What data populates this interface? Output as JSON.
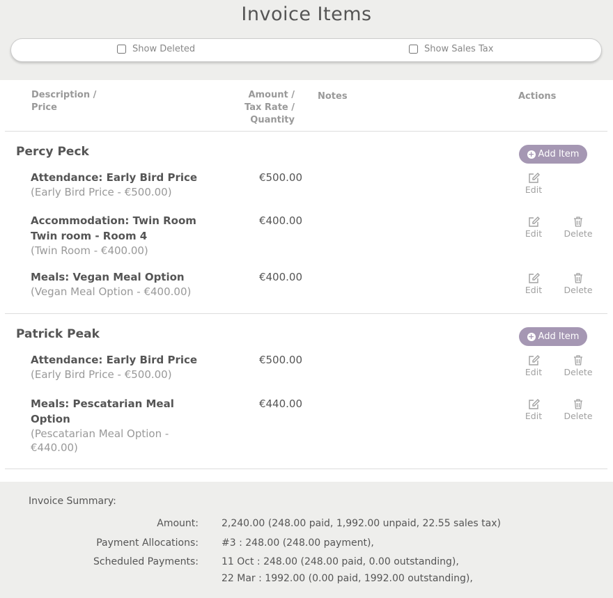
{
  "page": {
    "title": "Invoice Items"
  },
  "filters": {
    "show_deleted": "Show Deleted",
    "show_sales_tax": "Show Sales Tax"
  },
  "table": {
    "headers": {
      "description": [
        "Description /",
        "Price"
      ],
      "amount": [
        "Amount /",
        "Tax Rate /",
        "Quantity"
      ],
      "notes": "Notes",
      "actions": "Actions"
    },
    "labels": {
      "add_item": "Add Item",
      "edit": "Edit",
      "delete": "Delete"
    },
    "groups": [
      {
        "name": "Percy Peck",
        "items": [
          {
            "title": "Attendance: Early Bird Price",
            "subtitle": "(Early Bird Price - €500.00)",
            "amount": "€500.00",
            "deletable": false
          },
          {
            "title": "Accommodation: Twin Room Twin room - Room 4",
            "subtitle": "(Twin Room - €400.00)",
            "amount": "€400.00",
            "deletable": true
          },
          {
            "title": "Meals: Vegan Meal Option",
            "subtitle": "(Vegan Meal Option - €400.00)",
            "amount": "€400.00",
            "deletable": true
          }
        ]
      },
      {
        "name": "Patrick Peak",
        "items": [
          {
            "title": "Attendance: Early Bird Price",
            "subtitle": "(Early Bird Price - €500.00)",
            "amount": "€500.00",
            "deletable": true
          },
          {
            "title": "Meals: Pescatarian Meal Option",
            "subtitle": "(Pescatarian Meal Option - €440.00)",
            "amount": "€440.00",
            "deletable": true
          }
        ]
      }
    ]
  },
  "summary": {
    "title": "Invoice Summary:",
    "amount_label": "Amount:",
    "amount_value": "2,240.00 (248.00 paid, 1,992.00 unpaid, 22.55 sales tax)",
    "allocations_label": "Payment Allocations:",
    "allocations_value": "#3 : 248.00 (248.00 payment),",
    "scheduled_label": "Scheduled Payments:",
    "scheduled_values": [
      "11 Oct : 248.00 (248.00 paid, 0.00 outstanding),",
      "22 Mar : 1992.00 (0.00 paid, 1992.00 outstanding),"
    ]
  },
  "colors": {
    "accent": "#a597b3",
    "background": "#eeeeec",
    "muted_text": "#999999"
  },
  "icons": {
    "add": "plus-circle-icon",
    "edit": "edit-icon",
    "delete": "trash-icon"
  }
}
